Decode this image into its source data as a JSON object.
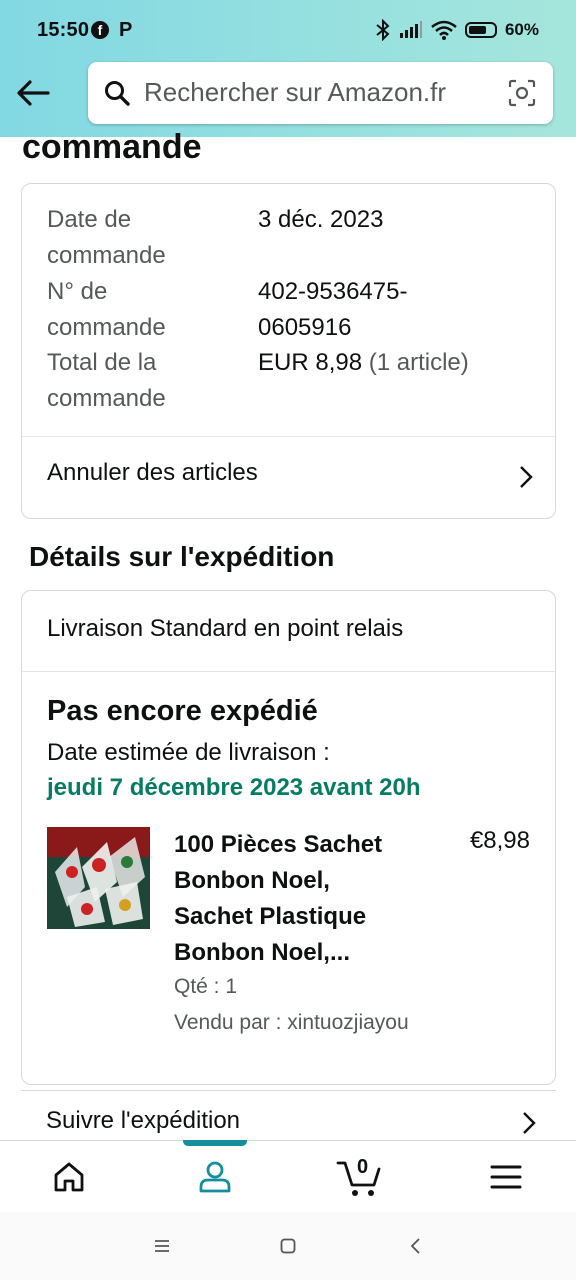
{
  "status_bar": {
    "time": "15:50",
    "fb_glyph": "f",
    "parking_glyph": "P",
    "battery": "60%",
    "battery_level": 0.6
  },
  "header": {
    "search_placeholder": "Rechercher sur Amazon.fr",
    "icons": [
      "back-arrow-icon",
      "search-icon",
      "camera-scan-icon"
    ]
  },
  "page": {
    "title_partial": "commande"
  },
  "order_summary": {
    "rows": [
      {
        "label_l1": "Date de",
        "label_l2": "commande",
        "value_l1": "3 déc. 2023",
        "value_l2": ""
      },
      {
        "label_l1": "N° de",
        "label_l2": "commande",
        "value_l1": "402-9536475-",
        "value_l2": "0605916"
      },
      {
        "label_l1": "Total de la",
        "label_l2": "commande",
        "value_l1": "EUR 8,98",
        "value_l1_muted": "(1 article)",
        "value_l2": ""
      }
    ],
    "cancel_label": "Annuler des articles"
  },
  "shipping": {
    "section_title": "Détails sur l'expédition",
    "method": "Livraison Standard en point relais",
    "status": "Pas encore expédié",
    "estimate_label": "Date estimée de livraison :",
    "estimate_date": "jeudi 7 décembre 2023 avant 20h",
    "product": {
      "title_lines": [
        "100 Pièces Sachet",
        "Bonbon Noel,",
        "Sachet Plastique",
        "Bonbon Noel,..."
      ],
      "price": "€8,98",
      "qty": "Qté : 1",
      "seller": "Vendu par : xintuozjiayou"
    },
    "track_label": "Suivre l'expédition"
  },
  "bottom_nav": {
    "cart_count": "0",
    "items": [
      "home-icon",
      "account-icon",
      "cart-icon",
      "menu-icon"
    ],
    "active": "account-icon"
  },
  "colors": {
    "header_gradient_start": "#82d8e3",
    "header_gradient_end": "#a5e6dc",
    "delivery_green": "#067d62",
    "active_teal": "#138e9e"
  }
}
